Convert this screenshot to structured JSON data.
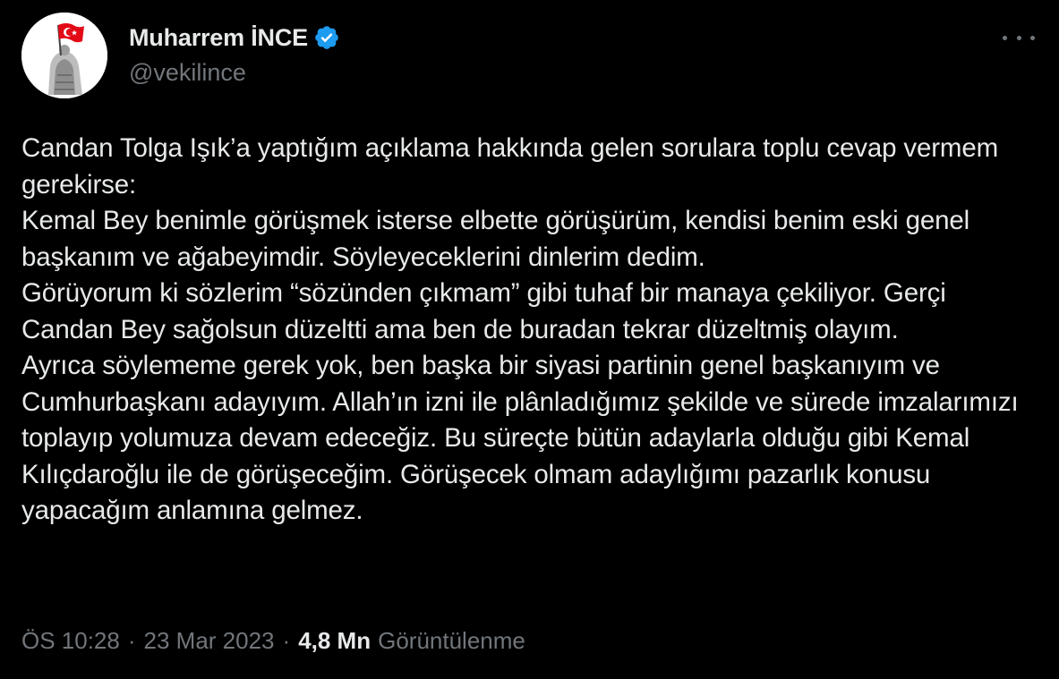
{
  "author": {
    "display_name": "Muharrem İNCE",
    "handle": "@vekilince",
    "verified": true
  },
  "icons": {
    "avatar": "profile-photo-flag",
    "verified": "verified-badge-icon",
    "more": "more-horizontal-icon"
  },
  "colors": {
    "background": "#000000",
    "text_primary": "#e7e9ea",
    "text_secondary": "#71767b",
    "verified_blue": "#1d9bf0"
  },
  "tweet": {
    "text": "Candan Tolga Işık’a yaptığım açıklama hakkında gelen sorulara toplu cevap vermem gerekirse:\nKemal Bey benimle görüşmek isterse elbette görüşürüm, kendisi benim eski genel başkanım ve ağabeyimdir. Söyleyeceklerini dinlerim dedim.\nGörüyorum ki sözlerim “sözünden çıkmam” gibi tuhaf bir manaya çekiliyor. Gerçi Candan Bey sağolsun düzeltti ama ben de buradan tekrar düzeltmiş olayım.\nAyrıca söylememe gerek yok, ben başka bir siyasi partinin genel başkanıyım ve Cumhurbaşkanı adayıyım. Allah’ın izni ile plânladığımız şekilde ve sürede imzalarımızı toplayıp yolumuza devam edeceğiz. Bu süreçte bütün adaylarla olduğu gibi Kemal Kılıçdaroğlu ile de görüşeceğim. Görüşecek olmam adaylığımı pazarlık konusu yapacağım anlamına gelmez."
  },
  "meta": {
    "time": "ÖS 10:28",
    "separator": "·",
    "date": "23 Mar 2023",
    "views_count": "4,8 Mn",
    "views_label": "Görüntülenme"
  }
}
